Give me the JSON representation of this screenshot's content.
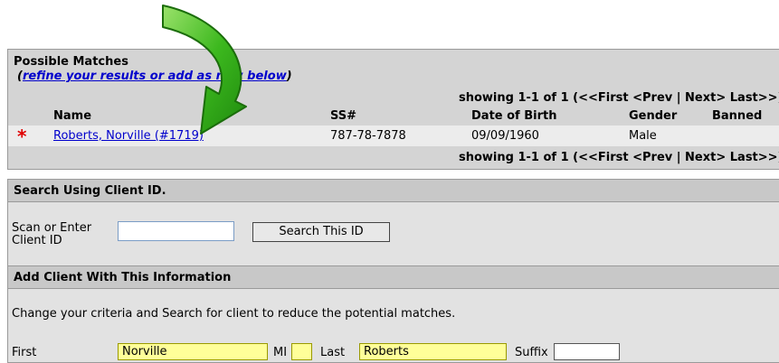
{
  "matches": {
    "title": "Possible Matches",
    "refine_link": "refine your results or add as new below",
    "open_paren": "(",
    "close_paren": ")",
    "pager_top": "showing 1-1 of 1 (<<First  <Prev | Next>  Last>>)",
    "pager_bottom": "showing 1-1 of 1 (<<First  <Prev | Next>  Last>>)",
    "columns": {
      "name": "Name",
      "ssn": "SS#",
      "dob": "Date of Birth",
      "gender": "Gender",
      "banned": "Banned"
    },
    "rows": [
      {
        "marker": "*",
        "name": "Roberts, Norville (#1719)",
        "ssn": "787-78-7878",
        "dob": "09/09/1960",
        "gender": "Male",
        "banned": ""
      }
    ]
  },
  "search": {
    "header": "Search Using Client ID.",
    "label": "Scan or Enter Client ID",
    "input_value": "",
    "button": "Search This ID"
  },
  "add": {
    "header": "Add Client With This Information",
    "instructions": "Change your criteria and Search for client to reduce the potential matches.",
    "first_label": "First",
    "first_value": "Norville",
    "mi_label": "MI",
    "mi_value": "",
    "last_label": "Last",
    "last_value": "Roberts",
    "suffix_label": "Suffix",
    "suffix_value": ""
  },
  "colors": {
    "arrow": "#3cb81e",
    "marker": "#e00000",
    "link": "#0000cc",
    "highlight": "#ffff99"
  }
}
